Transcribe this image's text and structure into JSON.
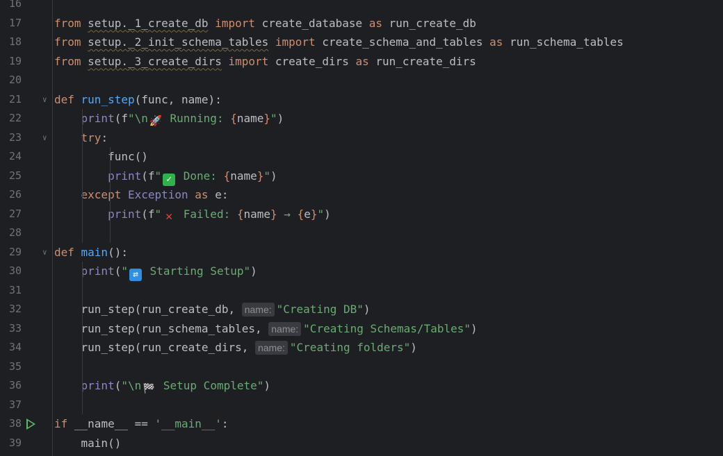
{
  "editor": {
    "lines": [
      {
        "n": "16",
        "tokens": []
      },
      {
        "n": "17",
        "tokens": [
          [
            "kw",
            "from "
          ],
          [
            "mod",
            "setup._1_create_db"
          ],
          [
            "kw",
            " import "
          ],
          [
            "pl",
            "create_database "
          ],
          [
            "kw",
            "as "
          ],
          [
            "pl",
            "run_create_db"
          ]
        ]
      },
      {
        "n": "18",
        "tokens": [
          [
            "kw",
            "from "
          ],
          [
            "mod",
            "setup._2_init_schema_tables"
          ],
          [
            "kw",
            " import "
          ],
          [
            "pl",
            "create_schema_and_tables "
          ],
          [
            "kw",
            "as "
          ],
          [
            "pl",
            "run_schema_tables"
          ]
        ]
      },
      {
        "n": "19",
        "tokens": [
          [
            "kw",
            "from "
          ],
          [
            "mod",
            "setup._3_create_dirs"
          ],
          [
            "kw",
            " import "
          ],
          [
            "pl",
            "create_dirs "
          ],
          [
            "kw",
            "as "
          ],
          [
            "pl",
            "run_create_dirs"
          ]
        ]
      },
      {
        "n": "20",
        "tokens": []
      },
      {
        "n": "21",
        "fold": true,
        "tokens": [
          [
            "kw",
            "def "
          ],
          [
            "fn",
            "run_step"
          ],
          [
            "pl",
            "(func, name):"
          ]
        ]
      },
      {
        "n": "22",
        "tokens": [
          [
            "pl",
            "    "
          ],
          [
            "bi",
            "print"
          ],
          [
            "pl",
            "(f"
          ],
          [
            "str",
            "\"\\n"
          ],
          [
            "emo-rocket",
            "🚀"
          ],
          [
            "str",
            " Running: "
          ],
          [
            "kw",
            "{"
          ],
          [
            "pl",
            "name"
          ],
          [
            "kw",
            "}"
          ],
          [
            "str",
            "\""
          ],
          [
            "pl",
            ")"
          ]
        ]
      },
      {
        "n": "23",
        "fold": true,
        "tokens": [
          [
            "pl",
            "    "
          ],
          [
            "kw",
            "try"
          ],
          [
            "pl",
            ":"
          ]
        ]
      },
      {
        "n": "24",
        "tokens": [
          [
            "pl",
            "        func()"
          ]
        ]
      },
      {
        "n": "25",
        "tokens": [
          [
            "pl",
            "        "
          ],
          [
            "bi",
            "print"
          ],
          [
            "pl",
            "(f"
          ],
          [
            "str",
            "\""
          ],
          [
            "emo-check",
            "✓"
          ],
          [
            "str",
            " Done: "
          ],
          [
            "kw",
            "{"
          ],
          [
            "pl",
            "name"
          ],
          [
            "kw",
            "}"
          ],
          [
            "str",
            "\""
          ],
          [
            "pl",
            ")"
          ]
        ]
      },
      {
        "n": "26",
        "tokens": [
          [
            "pl",
            "    "
          ],
          [
            "kw",
            "except "
          ],
          [
            "bi",
            "Exception "
          ],
          [
            "kw",
            "as "
          ],
          [
            "pl",
            "e:"
          ]
        ]
      },
      {
        "n": "27",
        "tokens": [
          [
            "pl",
            "        "
          ],
          [
            "bi",
            "print"
          ],
          [
            "pl",
            "(f"
          ],
          [
            "str",
            "\""
          ],
          [
            "emo-cross",
            "✕"
          ],
          [
            "str",
            " Failed: "
          ],
          [
            "kw",
            "{"
          ],
          [
            "pl",
            "name"
          ],
          [
            "kw",
            "}"
          ],
          [
            "str",
            " → "
          ],
          [
            "kw",
            "{"
          ],
          [
            "pl",
            "e"
          ],
          [
            "kw",
            "}"
          ],
          [
            "str",
            "\""
          ],
          [
            "pl",
            ")"
          ]
        ]
      },
      {
        "n": "28",
        "tokens": []
      },
      {
        "n": "29",
        "fold": true,
        "tokens": [
          [
            "kw",
            "def "
          ],
          [
            "fn",
            "main"
          ],
          [
            "pl",
            "():"
          ]
        ]
      },
      {
        "n": "30",
        "tokens": [
          [
            "pl",
            "    "
          ],
          [
            "bi",
            "print"
          ],
          [
            "pl",
            "("
          ],
          [
            "str",
            "\""
          ],
          [
            "emo-loop",
            "⇄"
          ],
          [
            "str",
            " Starting Setup\""
          ],
          [
            "pl",
            ")"
          ]
        ]
      },
      {
        "n": "31",
        "tokens": []
      },
      {
        "n": "32",
        "tokens": [
          [
            "pl",
            "    run_step(run_create_db, "
          ],
          [
            "hint",
            "name:"
          ],
          [
            "str",
            "\"Creating DB\""
          ],
          [
            "pl",
            ")"
          ]
        ]
      },
      {
        "n": "33",
        "tokens": [
          [
            "pl",
            "    run_step(run_schema_tables, "
          ],
          [
            "hint",
            "name:"
          ],
          [
            "str",
            "\"Creating Schemas/Tables\""
          ],
          [
            "pl",
            ")"
          ]
        ]
      },
      {
        "n": "34",
        "tokens": [
          [
            "pl",
            "    run_step(run_create_dirs, "
          ],
          [
            "hint",
            "name:"
          ],
          [
            "str",
            "\"Creating folders\""
          ],
          [
            "pl",
            ")"
          ]
        ]
      },
      {
        "n": "35",
        "tokens": []
      },
      {
        "n": "36",
        "tokens": [
          [
            "pl",
            "    "
          ],
          [
            "bi",
            "print"
          ],
          [
            "pl",
            "("
          ],
          [
            "str",
            "\"\\n"
          ],
          [
            "emo-flag",
            "🏁"
          ],
          [
            "str",
            " Setup Complete\""
          ],
          [
            "pl",
            ")"
          ]
        ]
      },
      {
        "n": "37",
        "tokens": []
      },
      {
        "n": "38",
        "run": true,
        "tokens": [
          [
            "kw",
            "if "
          ],
          [
            "pl",
            "__name__ == "
          ],
          [
            "str",
            "'__main__'"
          ],
          [
            "pl",
            ":"
          ]
        ]
      },
      {
        "n": "39",
        "tokens": [
          [
            "pl",
            "    main()"
          ]
        ]
      }
    ]
  },
  "icons": {
    "fold": "chevron-down-icon",
    "run": "run-gutter-icon"
  },
  "colors": {
    "background": "#1e1f22",
    "keyword": "#cf8e6d",
    "function": "#56a8f5",
    "builtin": "#8888c6",
    "string": "#6aab73",
    "line_number": "#6f737a"
  }
}
